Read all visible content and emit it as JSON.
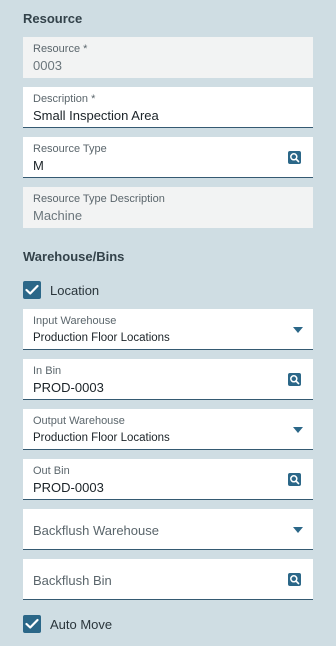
{
  "resource_section": {
    "title": "Resource",
    "resource": {
      "label": "Resource *",
      "value": "0003"
    },
    "description": {
      "label": "Description *",
      "value": "Small Inspection Area"
    },
    "resource_type": {
      "label": "Resource Type",
      "value": "M",
      "icon": "search-icon"
    },
    "resource_type_description": {
      "label": "Resource Type Description",
      "value": "Machine"
    }
  },
  "warehouse_section": {
    "title": "Warehouse/Bins",
    "location": {
      "label": "Location",
      "checked": true
    },
    "input_warehouse": {
      "label": "Input Warehouse",
      "value": "Production Floor Locations",
      "icon": "chevron-down-icon"
    },
    "in_bin": {
      "label": "In Bin",
      "value": "PROD-0003",
      "icon": "search-icon"
    },
    "output_warehouse": {
      "label": "Output Warehouse",
      "value": "Production Floor Locations",
      "icon": "chevron-down-icon"
    },
    "out_bin": {
      "label": "Out Bin",
      "value": "PROD-0003",
      "icon": "search-icon"
    },
    "backflush_warehouse": {
      "placeholder": "Backflush Warehouse",
      "icon": "chevron-down-icon"
    },
    "backflush_bin": {
      "placeholder": "Backflush Bin",
      "icon": "search-icon"
    },
    "auto_move": {
      "label": "Auto Move",
      "checked": true
    }
  },
  "colors": {
    "background": "#cfdde3",
    "accent": "#2b6788",
    "field_underline": "#355a72"
  }
}
